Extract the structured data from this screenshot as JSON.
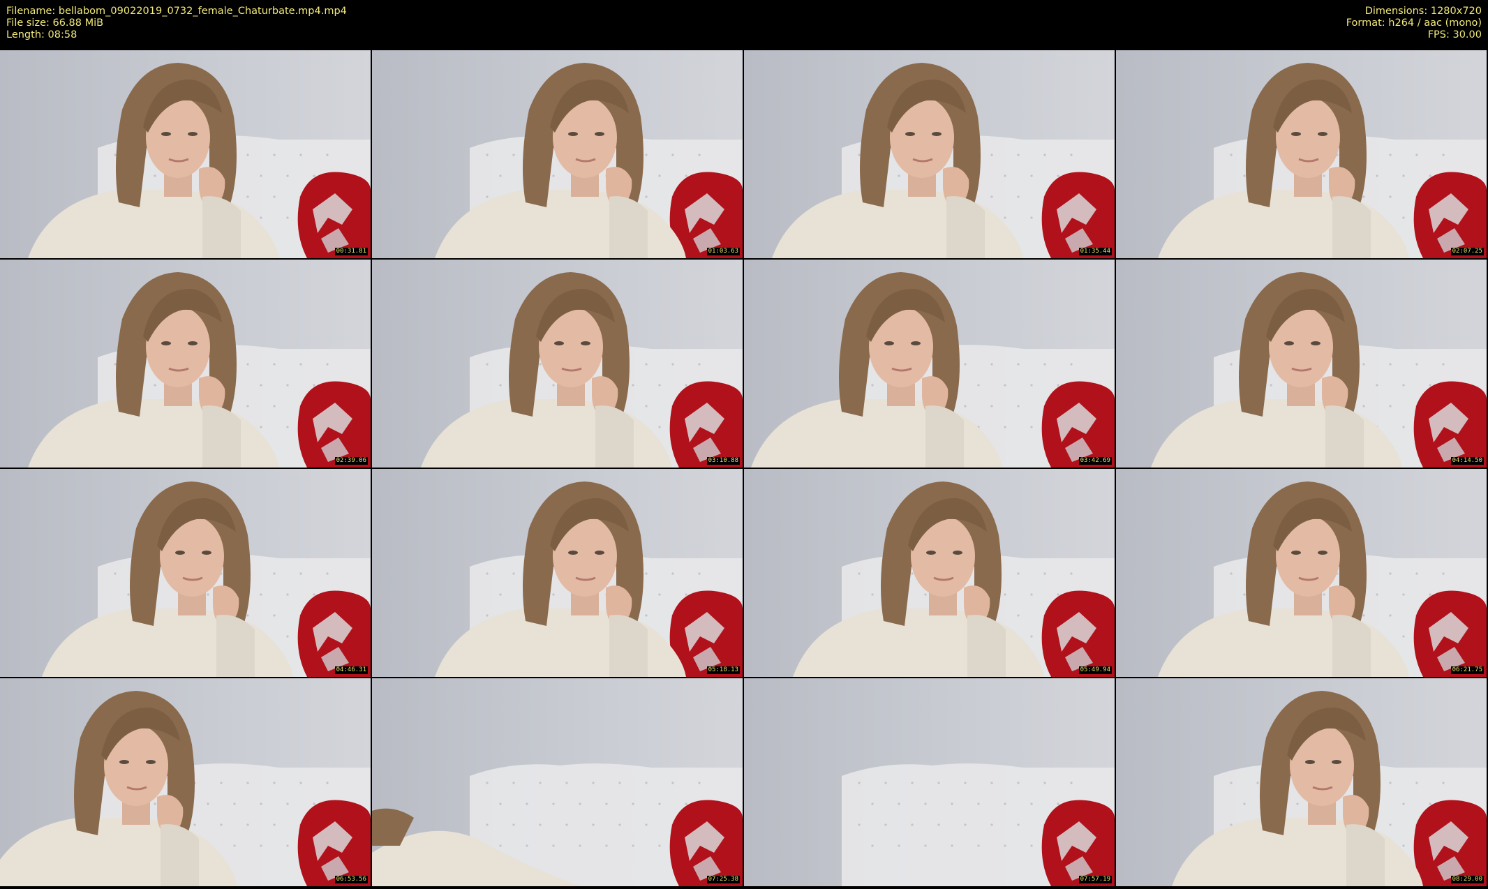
{
  "header": {
    "filename": "Filename: bellabom_09022019_0732_female_Chaturbate.mp4.mp4",
    "filesize": "File size: 66.88 MiB",
    "length": "Length: 08:58",
    "dimensions": "Dimensions: 1280x720",
    "format": "Format: h264 / aac (mono)",
    "fps": "FPS: 30.00"
  },
  "colors": {
    "header_text": "#f2e97a",
    "wall": "#c9ccd3",
    "sweater": "#e7e1d6",
    "hair": "#8a6a4d",
    "pillow": "#b0111a",
    "headboard": "#e8e8ea"
  },
  "frames": [
    {
      "timestamp": "00:31.81",
      "scene": "person"
    },
    {
      "timestamp": "01:03.63",
      "scene": "person"
    },
    {
      "timestamp": "01:35.44",
      "scene": "person"
    },
    {
      "timestamp": "02:07.25",
      "scene": "person"
    },
    {
      "timestamp": "02:39.06",
      "scene": "person"
    },
    {
      "timestamp": "03:10.88",
      "scene": "person"
    },
    {
      "timestamp": "03:42.69",
      "scene": "person"
    },
    {
      "timestamp": "04:14.50",
      "scene": "person"
    },
    {
      "timestamp": "04:46.31",
      "scene": "person"
    },
    {
      "timestamp": "05:18.13",
      "scene": "person"
    },
    {
      "timestamp": "05:49.94",
      "scene": "person"
    },
    {
      "timestamp": "06:21.75",
      "scene": "person"
    },
    {
      "timestamp": "06:53.56",
      "scene": "person"
    },
    {
      "timestamp": "07:25.38",
      "scene": "leaning"
    },
    {
      "timestamp": "07:57.19",
      "scene": "empty"
    },
    {
      "timestamp": "08:29.00",
      "scene": "person"
    }
  ]
}
